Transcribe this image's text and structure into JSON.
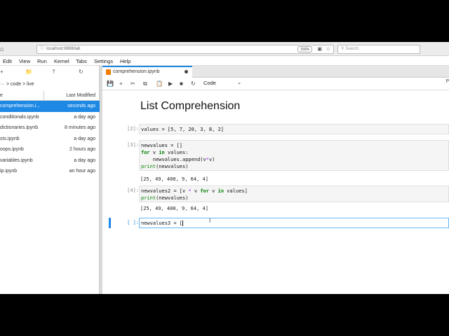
{
  "browser": {
    "url": "localhost:8888/lab",
    "zoom": "150%",
    "search_placeholder": "Search"
  },
  "menu": [
    "Edit",
    "View",
    "Run",
    "Kernel",
    "Tabs",
    "Settings",
    "Help"
  ],
  "file_browser": {
    "breadcrumb": "··· > code > live",
    "col_name": "e",
    "col_modified": "Last Modified",
    "files": [
      {
        "name": "comprehension.i...",
        "modified": "seconds ago",
        "selected": true
      },
      {
        "name": "conditionals.ipynb",
        "modified": "a day ago",
        "selected": false
      },
      {
        "name": "dictionaries.ipynb",
        "modified": "8 minutes ago",
        "selected": false
      },
      {
        "name": "sts.ipynb",
        "modified": "a day ago",
        "selected": false
      },
      {
        "name": "oops.ipynb",
        "modified": "2 hours ago",
        "selected": false
      },
      {
        "name": "variables.ipynb",
        "modified": "a day ago",
        "selected": false
      },
      {
        "name": "ip.ipynb",
        "modified": "an hour ago",
        "selected": false
      }
    ]
  },
  "tab": {
    "label": "comprehension.ipynb"
  },
  "toolbar": {
    "cell_type": "Code",
    "kernel_label": "P"
  },
  "notebook": {
    "title": "List Comprehension",
    "cells": [
      {
        "prompt": "[2]:",
        "code": "values = [5, 7, 20, 3, 8, 2]",
        "output": ""
      },
      {
        "prompt": "[3]:",
        "code": "newvalues = []\nfor v in values:\n    newvalues.append(v*v)\nprint(newvalues)",
        "output": "[25, 49, 400, 9, 64, 4]"
      },
      {
        "prompt": "[4]:",
        "code": "newvalues2 = [v * v for v in values]\nprint(newvalues)",
        "output": "[25, 49, 400, 9, 64, 4]"
      },
      {
        "prompt": "[ ]:",
        "code": "newvalues3 = [",
        "output": ""
      }
    ]
  },
  "colors": {
    "accent": "#1e88e5",
    "notebook_icon": "#f57c00"
  }
}
